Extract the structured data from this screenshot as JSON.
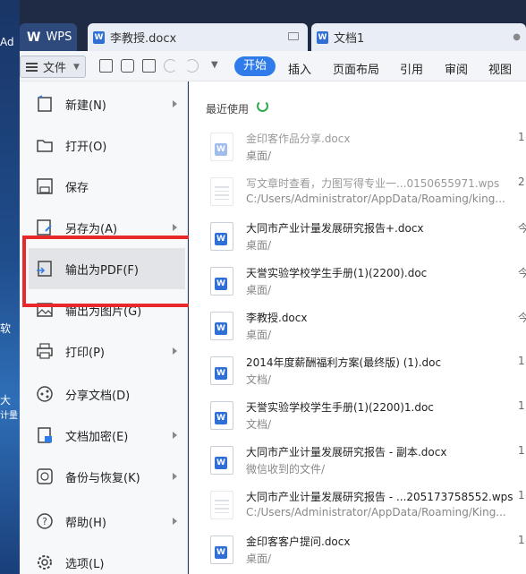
{
  "desktop": {
    "texts": [
      "Ad",
      "软",
      "大",
      "计量"
    ]
  },
  "tabs": {
    "wps": "WPS",
    "doc1": "李教授.docx",
    "doc2": "文档1"
  },
  "toolbar": {
    "file_label": "文件",
    "menu_tabs": [
      "开始",
      "插入",
      "页面布局",
      "引用",
      "审阅",
      "视图"
    ]
  },
  "file_menu": {
    "items": [
      {
        "label": "新建(N)",
        "icon": "new-file-icon",
        "arrow": true
      },
      {
        "label": "打开(O)",
        "icon": "folder-icon",
        "arrow": false
      },
      {
        "label": "保存",
        "icon": "save-icon",
        "arrow": false
      },
      {
        "label": "另存为(A)",
        "icon": "save-as-icon",
        "arrow": true
      },
      {
        "label": "输出为PDF(F)",
        "icon": "export-pdf-icon",
        "arrow": false
      },
      {
        "label": "输出为图片(G)",
        "icon": "image-icon",
        "arrow": false
      },
      {
        "label": "打印(P)",
        "icon": "print-icon",
        "arrow": true
      },
      {
        "label": "分享文档(D)",
        "icon": "share-icon",
        "arrow": false
      },
      {
        "label": "文档加密(E)",
        "icon": "lock-document-icon",
        "arrow": true
      },
      {
        "label": "备份与恢复(K)",
        "icon": "backup-icon",
        "arrow": true
      },
      {
        "label": "帮助(H)",
        "icon": "help-icon",
        "arrow": true
      },
      {
        "label": "选项(L)",
        "icon": "gear-icon",
        "arrow": false
      }
    ]
  },
  "recent": {
    "title": "最近使用",
    "files": [
      {
        "name": "金印客作品分享.docx",
        "path": "桌面/",
        "date": "1",
        "dim": true,
        "type": "doc"
      },
      {
        "name": "写文章时查看，力图写得专业一...0150655971.wps",
        "path": "C:/Users/Administrator/AppData/Roaming/king...",
        "date": "2",
        "dim": true,
        "type": "plain"
      },
      {
        "name": "大同市产业计量发展研究报告+.docx",
        "path": "桌面/",
        "date": "今",
        "dim": false,
        "type": "doc"
      },
      {
        "name": "天誉实验学校学生手册(1)(2200).doc",
        "path": "桌面/",
        "date": "今",
        "dim": false,
        "type": "doc"
      },
      {
        "name": "李教授.docx",
        "path": "桌面/",
        "date": "今",
        "dim": false,
        "type": "doc"
      },
      {
        "name": "2014年度薪酬福利方案(最终版) (1).doc",
        "path": "文档/",
        "date": "1",
        "dim": false,
        "type": "doc"
      },
      {
        "name": "天誉实验学校学生手册(1)(2200)1.doc",
        "path": "文档/",
        "date": "1",
        "dim": false,
        "type": "doc"
      },
      {
        "name": "大同市产业计量发展研究报告 - 副本.docx",
        "path": "微信收到的文件/",
        "date": "1",
        "dim": false,
        "type": "doc"
      },
      {
        "name": "大同市产业计量发展研究报告 - ...205173758552.wps",
        "path": "C:/Users/Administrator/AppData/Roaming/King...",
        "date": "1",
        "dim": false,
        "type": "plain"
      },
      {
        "name": "金印客客户提问.docx",
        "path": "桌面/",
        "date": "1",
        "dim": false,
        "type": "doc"
      }
    ]
  }
}
